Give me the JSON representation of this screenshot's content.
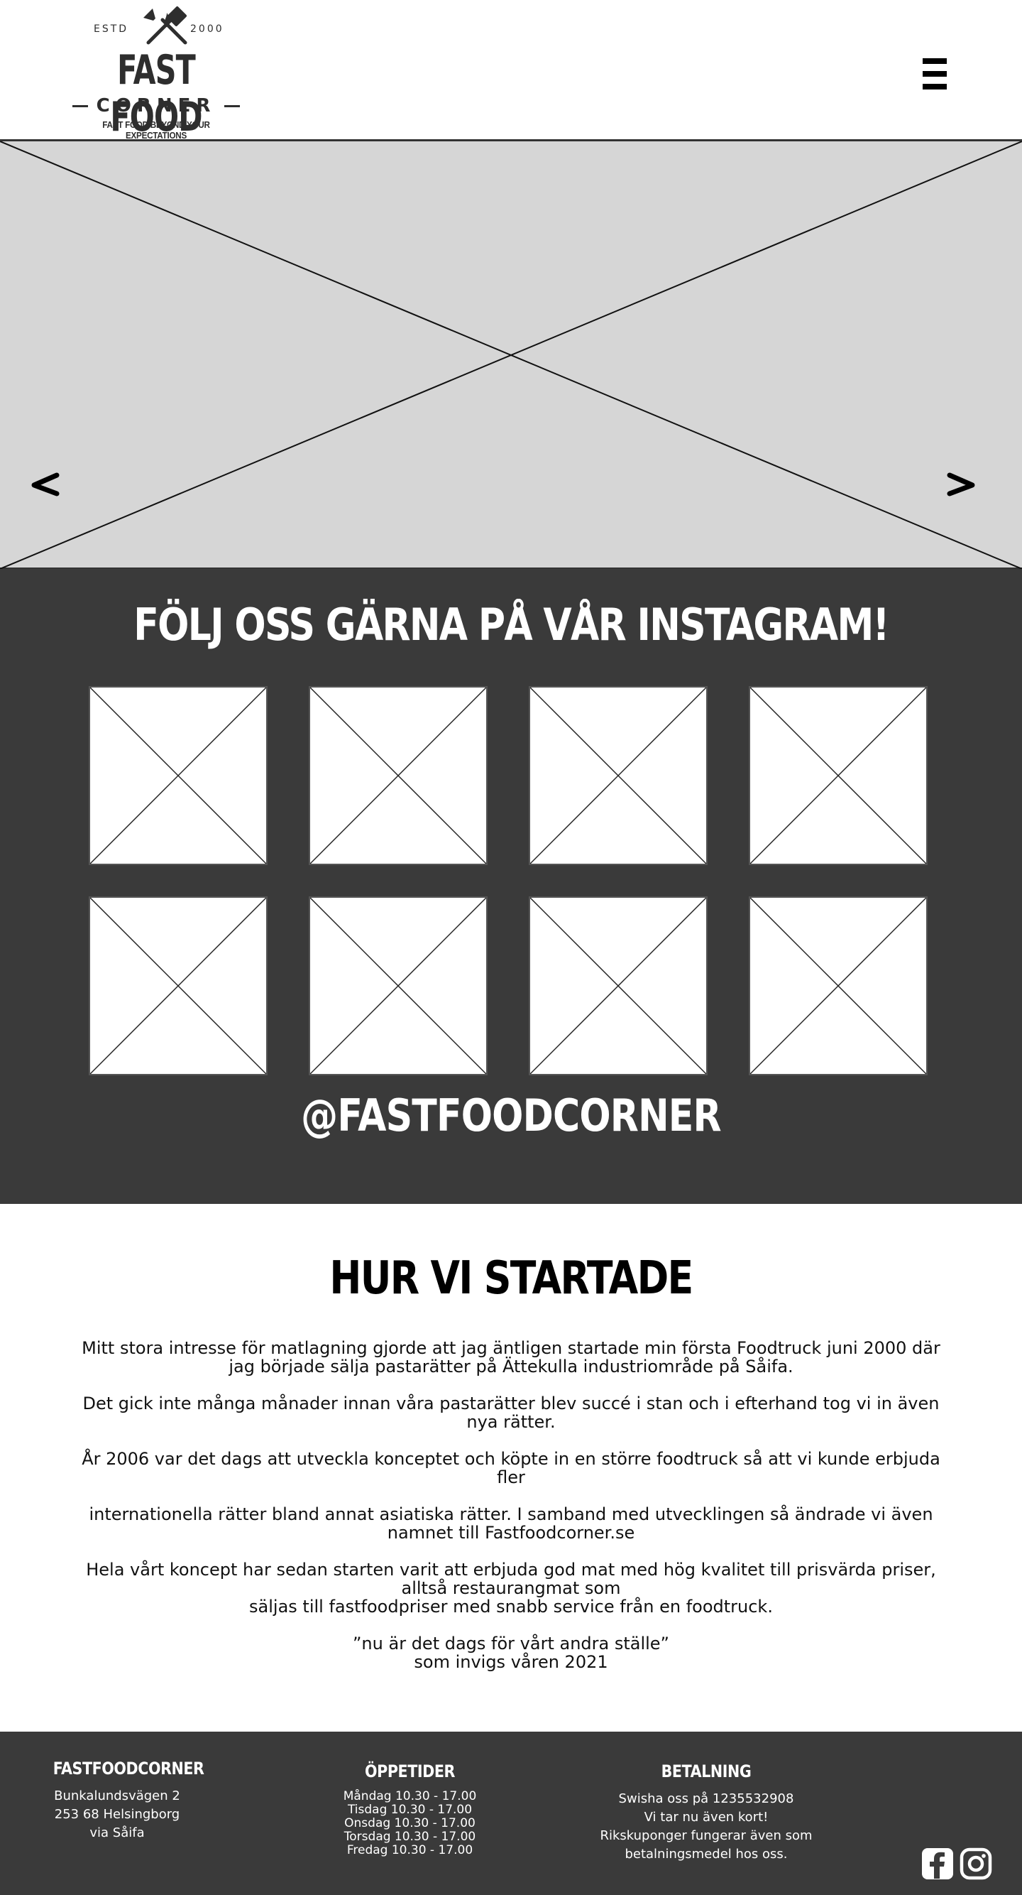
{
  "header": {
    "logo": {
      "estd": "ESTD",
      "year": "2000",
      "name": "FAST FOOD",
      "sub": "CORNER",
      "tagline": "FAST FOOD BEYOND YOUR EXPECTATIONS"
    },
    "menu_icon": "hamburger-icon"
  },
  "hero": {
    "prev_icon": "chevron-left-icon",
    "next_icon": "chevron-right-icon"
  },
  "instagram": {
    "title": "FÖLJ OSS GÄRNA PÅ VÅR INSTAGRAM!",
    "handle": "@FASTFOODCORNER",
    "tiles": 8
  },
  "story": {
    "title": "HUR VI STARTADE",
    "paragraphs": [
      "Mitt stora intresse för matlagning gjorde att jag äntligen startade min första Foodtruck juni 2000 där jag började sälja pastarätter på Ättekulla industriområde på Såifa.",
      "Det gick inte många månader innan våra pastarätter blev succé i stan och i efterhand tog vi in även nya rätter.",
      "År 2006 var det dags att utveckla konceptet och köpte in en större foodtruck så att vi kunde erbjuda fler",
      "internationella rätter bland annat asiatiska rätter. I samband med utvecklingen så ändrade vi även namnet till Fastfoodcorner.se",
      "Hela vårt koncept har sedan starten varit att erbjuda god mat med hög kvalitet till prisvärda priser, alltså restaurangmat som",
      "säljas till fastfoodpriser med snabb service från en foodtruck.",
      "”nu är det dags för vårt andra ställe”",
      "som invigs våren 2021"
    ]
  },
  "footer": {
    "brand": {
      "title": "FASTFOODCORNER",
      "line1": "Bunkalundsvägen 2",
      "line2": "253 68 Helsingborg",
      "line3": "via Såifa"
    },
    "hours": {
      "title": "ÖPPETIDER",
      "mon": "Måndag 10.30 - 17.00",
      "tue": "Tisdag 10.30 - 17.00",
      "wed": "Onsdag 10.30 - 17.00",
      "thu": "Torsdag 10.30 - 17.00",
      "fri": "Fredag 10.30 - 17.00"
    },
    "payment": {
      "title": "BETALNING",
      "line1": "Swisha oss på 1235532908",
      "line2": "Vi tar nu även kort!",
      "line3": "Rikskuponger fungerar även som",
      "line4": "betalningsmedel hos oss."
    },
    "social": {
      "facebook_icon": "facebook-icon",
      "instagram_icon": "instagram-icon"
    }
  }
}
